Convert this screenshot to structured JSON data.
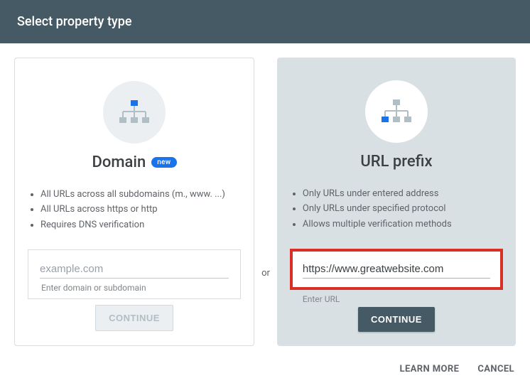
{
  "header": {
    "title": "Select property type"
  },
  "domainCard": {
    "title": "Domain",
    "badge": "new",
    "bullets": [
      "All URLs across all subdomains (m., www. ...)",
      "All URLs across https or http",
      "Requires DNS verification"
    ],
    "input": {
      "placeholder": "example.com",
      "value": "",
      "helper": "Enter domain or subdomain"
    },
    "button": "CONTINUE"
  },
  "separator": "or",
  "urlCard": {
    "title": "URL prefix",
    "bullets": [
      "Only URLs under entered address",
      "Only URLs under specified protocol",
      "Allows multiple verification methods"
    ],
    "input": {
      "placeholder": "",
      "value": "https://www.greatwebsite.com",
      "helper": "Enter URL"
    },
    "button": "CONTINUE"
  },
  "footer": {
    "learnMore": "LEARN MORE",
    "cancel": "CANCEL"
  },
  "colors": {
    "headerBg": "#455a64",
    "badge": "#1a73e8",
    "highlight": "#d93025",
    "nodeBlue": "#1a73e8",
    "nodeGrey": "#b0bec5"
  }
}
